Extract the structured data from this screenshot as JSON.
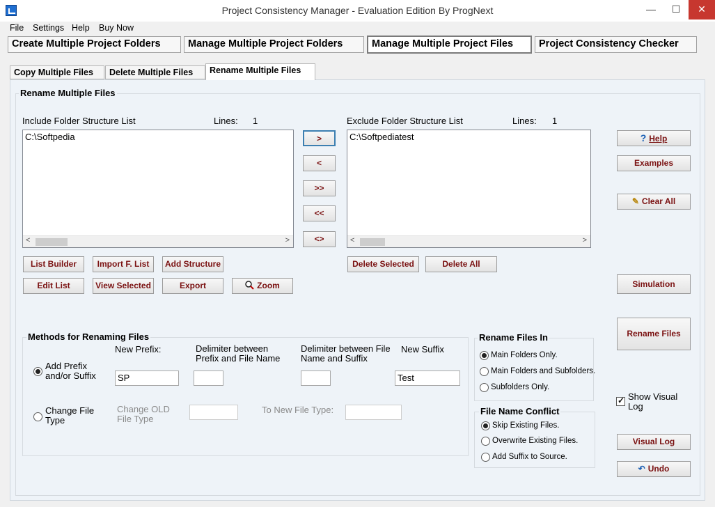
{
  "window": {
    "title": "Project Consistency Manager - Evaluation Edition  By ProgNext",
    "min": "—",
    "max": "☐",
    "close": "✕"
  },
  "menu": [
    "File",
    "Settings",
    "Help",
    "Buy Now"
  ],
  "main_tabs": [
    "Create Multiple Project Folders",
    "Manage Multiple Project Folders",
    "Manage Multiple Project Files",
    "Project Consistency Checker"
  ],
  "sub_tabs": [
    "Copy Multiple Files",
    "Delete Multiple Files",
    "Rename Multiple Files"
  ],
  "panel": {
    "group_title": "Rename Multiple Files",
    "include": {
      "label": "Include Folder Structure List",
      "lines_label": "Lines:",
      "lines_value": "1",
      "items": [
        "C:\\Softpedia"
      ]
    },
    "exclude": {
      "label": "Exclude Folder Structure List",
      "lines_label": "Lines:",
      "lines_value": "1",
      "items": [
        "C:\\Softpediatest"
      ]
    },
    "arrow_buttons": [
      ">",
      "<",
      ">>",
      "<<",
      "<>"
    ],
    "include_buttons": [
      "List Builder",
      "Import F. List",
      "Add Structure",
      "Edit List",
      "View Selected",
      "Export",
      "Zoom"
    ],
    "exclude_buttons": [
      "Delete Selected",
      "Delete All"
    ],
    "side_buttons": {
      "help": "Help",
      "examples": "Examples",
      "clear_all": "Clear All",
      "simulation": "Simulation",
      "rename_files": "Rename  Files",
      "visual_log": "Visual Log",
      "undo": "Undo"
    },
    "show_visual_log": {
      "label": "Show Visual Log",
      "checked": true
    }
  },
  "methods": {
    "title": "Methods for Renaming Files",
    "headers": {
      "prefix": "New Prefix:",
      "delim_prefix": "Delimiter between Prefix and File Name",
      "delim_suffix": "Delimiter between File Name and Suffix",
      "suffix": "New Suffix"
    },
    "option_add": "Add Prefix and/or Suffix",
    "option_change": "Change File Type",
    "prefix_value": "SP",
    "delim_prefix_value": "",
    "delim_suffix_value": "",
    "suffix_value": "Test",
    "change_old_label": "Change OLD File Type",
    "to_new_label": "To New File Type:",
    "selected": "add"
  },
  "rename_in": {
    "title": "Rename Files In",
    "options": [
      "Main Folders Only.",
      "Main Folders and Subfolders.",
      "Subfolders Only."
    ],
    "selected": 0
  },
  "conflict": {
    "title": "File Name Conflict",
    "options": [
      "Skip Existing Files.",
      "Overwrite Existing Files.",
      "Add Suffix to Source."
    ],
    "selected": 0
  },
  "colors": {
    "button_text": "#7a1111",
    "panel_bg": "#eef3f8",
    "close_bg": "#c7372f"
  }
}
